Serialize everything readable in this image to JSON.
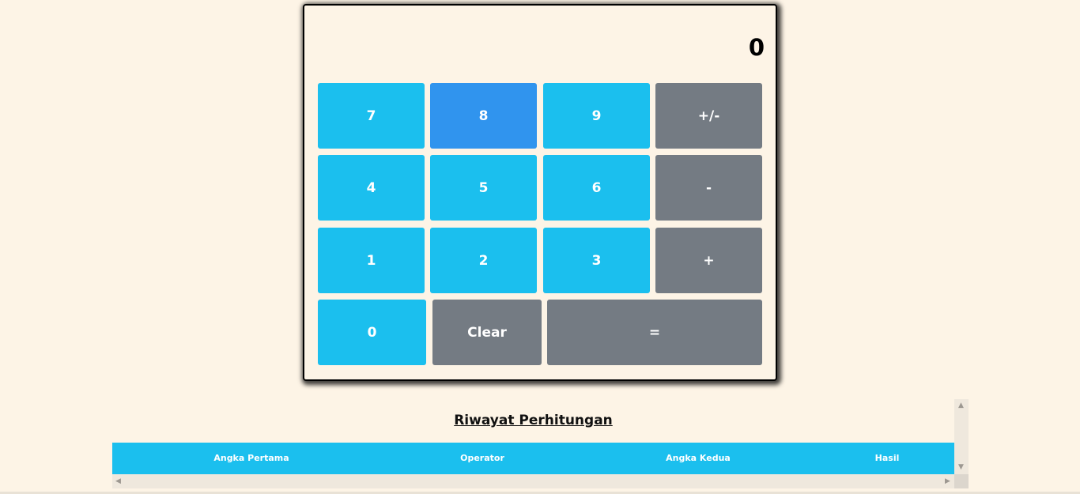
{
  "calculator": {
    "display": "0",
    "keys": {
      "k7": "7",
      "k8": "8",
      "k9": "9",
      "negate": "+/-",
      "k4": "4",
      "k5": "5",
      "k6": "6",
      "minus": "-",
      "k1": "1",
      "k2": "2",
      "k3": "3",
      "plus": "+",
      "k0": "0",
      "clear": "Clear",
      "equals": "="
    }
  },
  "history": {
    "title": "Riwayat Perhitungan",
    "columns": [
      "Angka Pertama",
      "Operator",
      "Angka Kedua",
      "Hasil"
    ]
  },
  "colors": {
    "digit_key": "#1bbfee",
    "digit_key_active": "#3094ee",
    "operator_key": "#747b83",
    "background": "#fdf4e6"
  }
}
